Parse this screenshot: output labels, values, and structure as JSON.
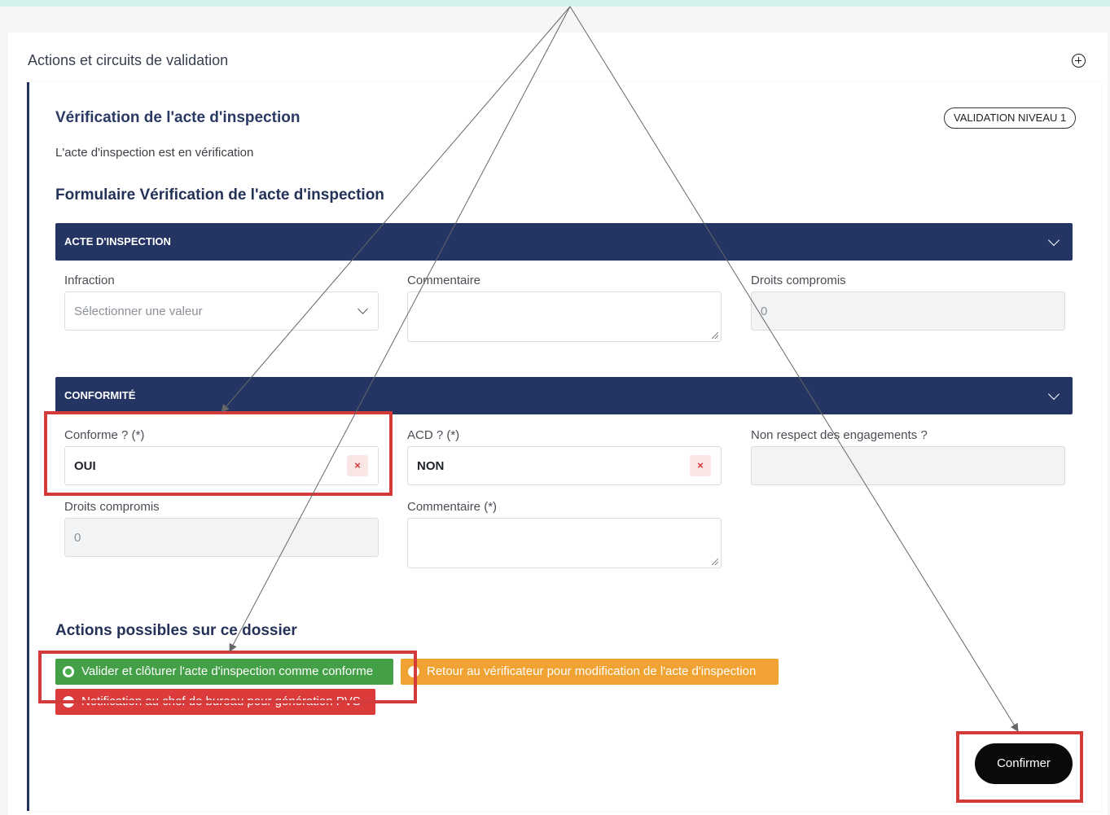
{
  "header": {
    "section_title": "Actions et circuits de validation",
    "add_icon": "plus-circle-icon"
  },
  "card": {
    "title": "Vérification de l'acte d'inspection",
    "badge": "VALIDATION NIVEAU 1",
    "status": "L'acte d'inspection est en vérification",
    "form_title": "Formulaire Vérification de l'acte d'inspection"
  },
  "sections": {
    "acte": {
      "title": "ACTE D'INSPECTION",
      "infraction": {
        "label": "Infraction",
        "placeholder": "Sélectionner une valeur"
      },
      "commentaire": {
        "label": "Commentaire",
        "value": ""
      },
      "droits": {
        "label": "Droits compromis",
        "value": "0"
      }
    },
    "conformite": {
      "title": "CONFORMITÉ",
      "conforme": {
        "label": "Conforme ? (*)",
        "value": "OUI",
        "clear": "×"
      },
      "acd": {
        "label": "ACD ? (*)",
        "value": "NON",
        "clear": "×"
      },
      "non_respect": {
        "label": "Non respect des engagements ?",
        "value": ""
      },
      "droits": {
        "label": "Droits compromis",
        "value": "0"
      },
      "commentaire": {
        "label": "Commentaire (*)",
        "value": ""
      }
    }
  },
  "actions": {
    "title": "Actions possibles sur ce dossier",
    "options": [
      {
        "label": "Valider et clôturer l'acte d'inspection comme conforme",
        "color": "#43a047",
        "selected": true
      },
      {
        "label": "Retour au vérificateur pour modification de l'acte d'inspection",
        "color": "#f0a232",
        "selected": false
      },
      {
        "label": "Notification au chef de bureau pour génération PVS",
        "color": "#dc3b3b",
        "selected": false
      }
    ],
    "confirm_label": "Confirmer"
  },
  "annotations": {
    "highlight_color": "#d33a3a"
  }
}
